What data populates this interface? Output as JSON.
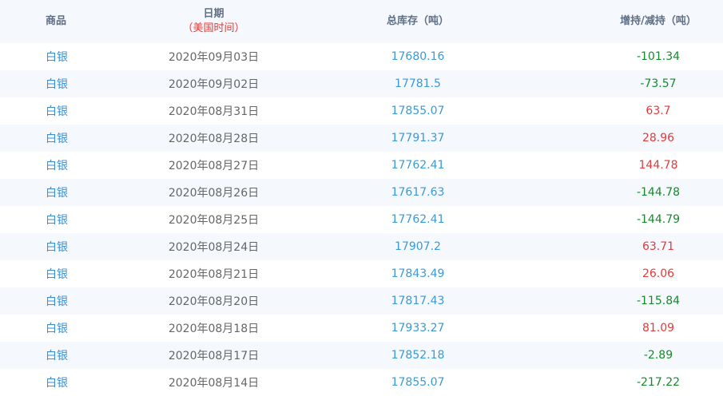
{
  "header": {
    "product": "商品",
    "date": "日期",
    "date_sub": "（美国时间）",
    "total": "总库存（吨）",
    "change": "增持/减持（吨）"
  },
  "rows": [
    {
      "product": "白银",
      "date": "2020年09月03日",
      "total": "17680.16",
      "change": "-101.34",
      "dir": "neg"
    },
    {
      "product": "白银",
      "date": "2020年09月02日",
      "total": "17781.5",
      "change": "-73.57",
      "dir": "neg"
    },
    {
      "product": "白银",
      "date": "2020年08月31日",
      "total": "17855.07",
      "change": "63.7",
      "dir": "pos"
    },
    {
      "product": "白银",
      "date": "2020年08月28日",
      "total": "17791.37",
      "change": "28.96",
      "dir": "pos"
    },
    {
      "product": "白银",
      "date": "2020年08月27日",
      "total": "17762.41",
      "change": "144.78",
      "dir": "pos"
    },
    {
      "product": "白银",
      "date": "2020年08月26日",
      "total": "17617.63",
      "change": "-144.78",
      "dir": "neg"
    },
    {
      "product": "白银",
      "date": "2020年08月25日",
      "total": "17762.41",
      "change": "-144.79",
      "dir": "neg"
    },
    {
      "product": "白银",
      "date": "2020年08月24日",
      "total": "17907.2",
      "change": "63.71",
      "dir": "pos"
    },
    {
      "product": "白银",
      "date": "2020年08月21日",
      "total": "17843.49",
      "change": "26.06",
      "dir": "pos"
    },
    {
      "product": "白银",
      "date": "2020年08月20日",
      "total": "17817.43",
      "change": "-115.84",
      "dir": "neg"
    },
    {
      "product": "白银",
      "date": "2020年08月18日",
      "total": "17933.27",
      "change": "81.09",
      "dir": "pos"
    },
    {
      "product": "白银",
      "date": "2020年08月17日",
      "total": "17852.18",
      "change": "-2.89",
      "dir": "neg"
    },
    {
      "product": "白银",
      "date": "2020年08月14日",
      "total": "17855.07",
      "change": "-217.22",
      "dir": "neg"
    }
  ],
  "colors": {
    "link": "#3a8fd6",
    "increase": "#e33b3b",
    "decrease": "#178a2c",
    "stripe": "#f5f8fc"
  }
}
